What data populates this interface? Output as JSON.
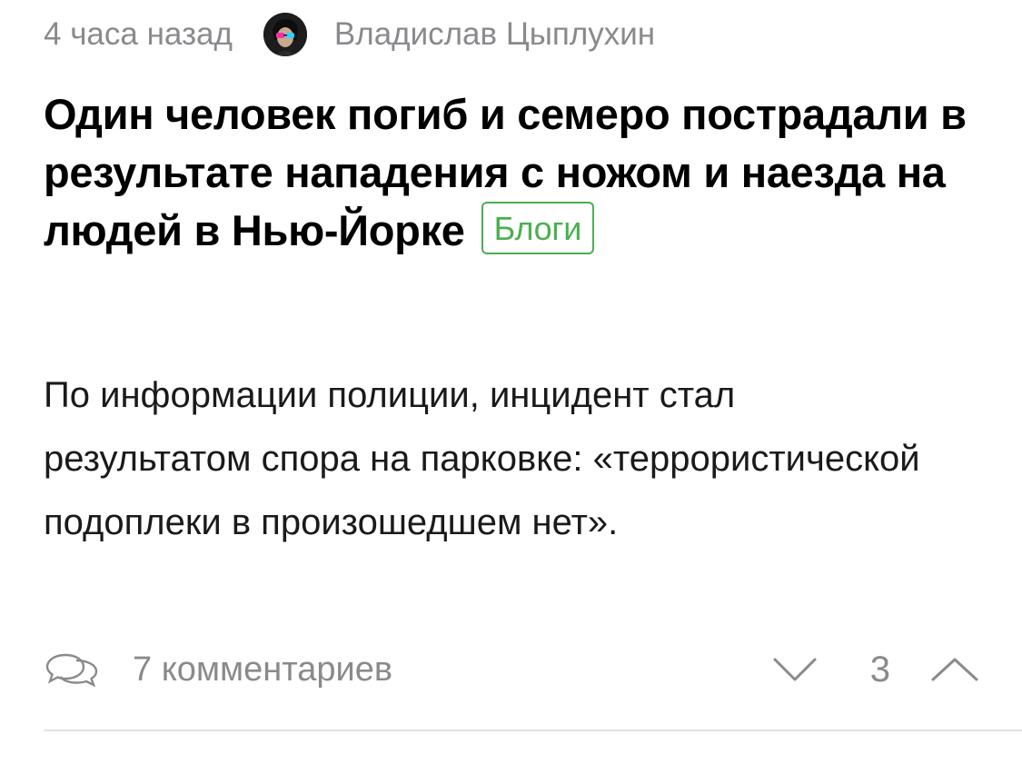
{
  "post": {
    "time": "4 часа назад",
    "author": "Владислав Цыплухин",
    "title": "Один человек погиб и семеро пострадали в результате нападения с ножом и наезда на людей в Нью-Йорке",
    "tag": "Блоги",
    "excerpt": "По информации полиции, инцидент стал результатом спора на парковке: «террористической подоплеки в произошедшем нет».",
    "comments_label": "7 комментариев",
    "score": "3"
  },
  "icons": {
    "avatar": "author-avatar",
    "comments": "speech-bubbles-icon",
    "downvote": "chevron-down-icon",
    "upvote": "chevron-up-icon"
  },
  "colors": {
    "meta_text": "#8a8a8e",
    "tag_green": "#4caf50",
    "divider": "#e2e2e4"
  }
}
